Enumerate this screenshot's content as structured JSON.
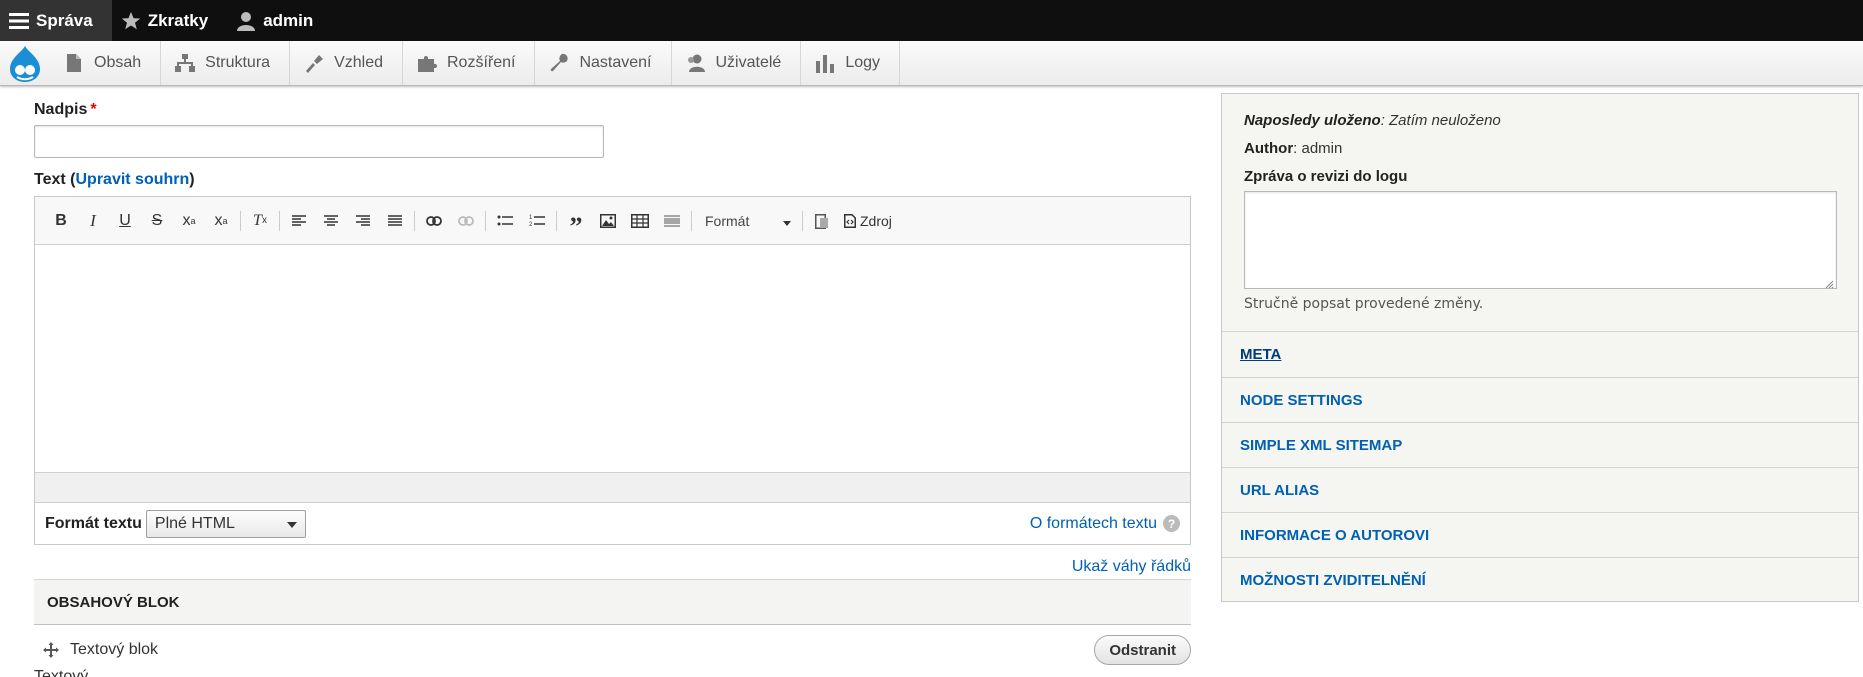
{
  "toolbar": {
    "items": [
      {
        "label": "Správa",
        "icon": "hamburger-icon"
      },
      {
        "label": "Zkratky",
        "icon": "star-icon"
      },
      {
        "label": "admin",
        "icon": "user-icon"
      }
    ]
  },
  "tray": {
    "logo": "drupal-logo",
    "items": [
      {
        "label": "Obsah",
        "icon": "file-icon"
      },
      {
        "label": "Struktura",
        "icon": "sitemap-icon"
      },
      {
        "label": "Vzhled",
        "icon": "paintbrush-icon"
      },
      {
        "label": "Rozšíření",
        "icon": "puzzle-icon"
      },
      {
        "label": "Nastavení",
        "icon": "wrench-icon"
      },
      {
        "label": "Uživatelé",
        "icon": "users-icon"
      },
      {
        "label": "Logy",
        "icon": "bar-chart-icon"
      }
    ]
  },
  "form": {
    "title_label": "Nadpis",
    "required_mark": "*",
    "title_value": "",
    "text_label": "Text (",
    "text_link": "Upravit souhrn",
    "text_label_end": ")",
    "editor": {
      "format_dropdown": "Formát",
      "source_label": "Zdroj"
    },
    "text_format_label": "Formát textu",
    "text_format_value": "Plné HTML",
    "about_formats": "O formátech textu",
    "help_mark": "?",
    "show_weights": "Ukaž váhy řádků",
    "block_header": "OBSAHOVÝ BLOK",
    "block_item": "Textový blok",
    "remove_button": "Odstranit",
    "cutoff_text": "Textový"
  },
  "sidebar": {
    "last_saved_label": "Naposledy uloženo",
    "last_saved_value": ": Zatím neuloženo",
    "author_label": "Author",
    "author_value": ": admin",
    "revision_label": "Zpráva o revizi do logu",
    "revision_value": "",
    "revision_desc": "Stručně popsat provedené změny.",
    "sections": [
      "META",
      "NODE SETTINGS",
      "SIMPLE XML SITEMAP",
      "URL ALIAS",
      "INFORMACE O AUTOROVI",
      "MOŽNOSTI ZVIDITELNĚNÍ"
    ]
  }
}
